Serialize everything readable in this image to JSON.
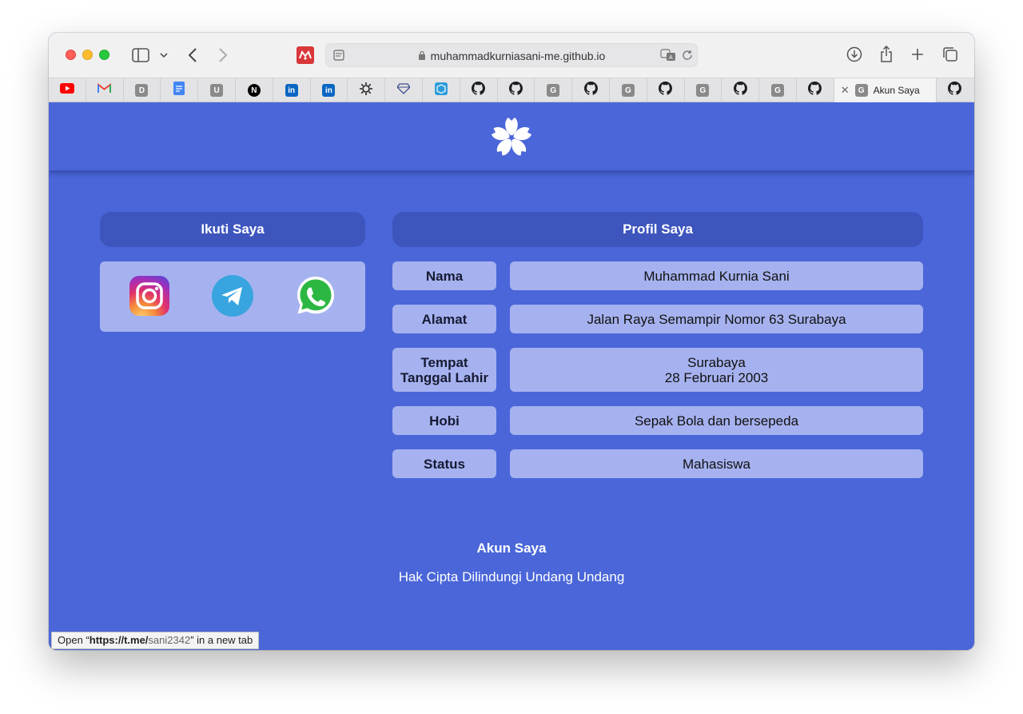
{
  "browser": {
    "address": "muhammadkurniasani-me.github.io",
    "active_tab_title": "Akun Saya",
    "status_prefix": "Open “",
    "status_url_bold": "https://t.me/",
    "status_url_rest": "sani2342",
    "status_suffix": "” in a new tab"
  },
  "tabs": [
    {
      "icon": "youtube-icon"
    },
    {
      "icon": "gmail-icon"
    },
    {
      "icon": "d-favicon",
      "letter": "D"
    },
    {
      "icon": "docs-icon"
    },
    {
      "icon": "u-favicon",
      "letter": "U"
    },
    {
      "icon": "next-icon",
      "letter": "N"
    },
    {
      "icon": "linkedin-icon",
      "letter": "in"
    },
    {
      "icon": "linkedin-icon",
      "letter": "in"
    },
    {
      "icon": "gear-icon"
    },
    {
      "icon": "diamond-icon"
    },
    {
      "icon": "box-icon"
    },
    {
      "icon": "github-icon"
    },
    {
      "icon": "github-icon"
    },
    {
      "icon": "g-favicon",
      "letter": "G"
    },
    {
      "icon": "github-icon"
    },
    {
      "icon": "g-favicon",
      "letter": "G"
    },
    {
      "icon": "github-icon"
    },
    {
      "icon": "g-favicon",
      "letter": "G"
    },
    {
      "icon": "github-icon"
    },
    {
      "icon": "g-favicon",
      "letter": "G"
    },
    {
      "icon": "github-icon"
    }
  ],
  "sidebar": {
    "title": "Ikuti Saya",
    "social": [
      "instagram-icon",
      "telegram-icon",
      "whatsapp-icon"
    ]
  },
  "profile": {
    "title": "Profil Saya",
    "rows": [
      {
        "label": "Nama",
        "value": "Muhammad Kurnia Sani"
      },
      {
        "label": "Alamat",
        "value": "Jalan Raya Semampir Nomor 63 Surabaya"
      },
      {
        "label": "Tempat",
        "label2": "Tanggal Lahir",
        "value": "Surabaya",
        "value2": "28 Februari 2003"
      },
      {
        "label": "Hobi",
        "value": "Sepak Bola dan bersepeda"
      },
      {
        "label": "Status",
        "value": "Mahasiswa"
      }
    ]
  },
  "footer": {
    "title": "Akun Saya",
    "copyright": "Hak Cipta Dilindungi Undang Undang"
  },
  "colors": {
    "page_bg": "#4a66d9",
    "panel_title_bg": "#3d55bd",
    "cell_bg": "#a6b2ef"
  }
}
